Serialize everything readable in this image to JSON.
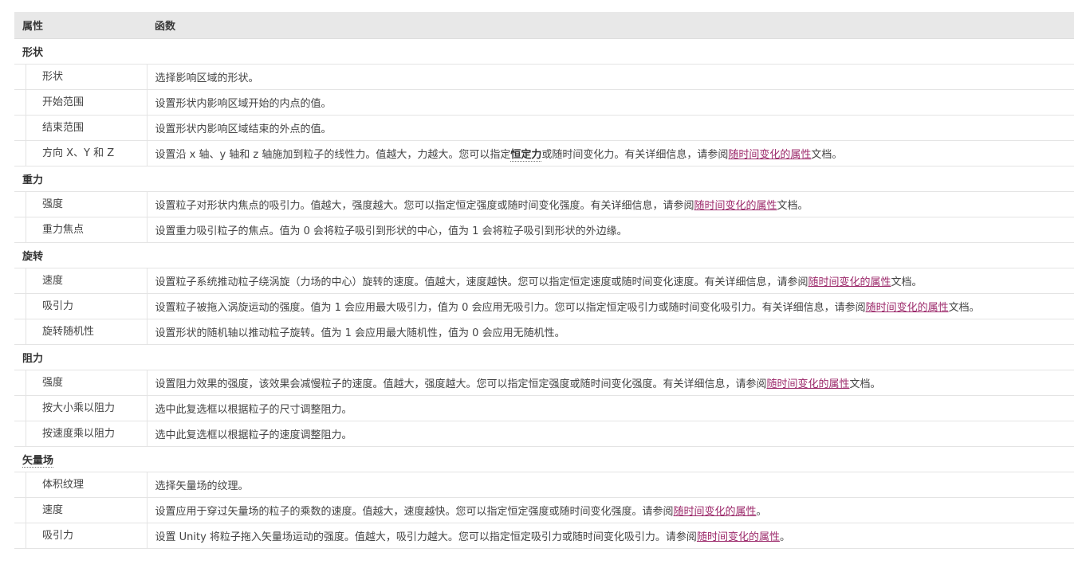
{
  "header": {
    "prop": "属性",
    "func": "函数"
  },
  "sections": [
    {
      "title": "形状",
      "rows": [
        {
          "prop": "形状",
          "before": "选择影响区域的形状。"
        },
        {
          "prop": "开始范围",
          "before": "设置形状内影响区域开始的内点的值。"
        },
        {
          "prop": "结束范围",
          "before": "设置形状内影响区域结束的外点的值。"
        },
        {
          "prop": "方向 X、Y 和 Z",
          "before": "设置沿 x 轴、y 轴和 z 轴施加到粒子的线性力。值越大，力越大。您可以指定",
          "term": "恒定力",
          "middle": "或随时间变化力。有关详细信息，请参阅",
          "link": "随时间变化的属性",
          "after": "文档。"
        }
      ]
    },
    {
      "title": "重力",
      "rows": [
        {
          "prop": "强度",
          "before": "设置粒子对形状内焦点的吸引力。值越大，强度越大。您可以指定恒定强度或随时间变化强度。有关详细信息，请参阅",
          "link": "随时间变化的属性",
          "after": "文档。"
        },
        {
          "prop": "重力焦点",
          "before": "设置重力吸引粒子的焦点。值为 0 会将粒子吸引到形状的中心，值为 1 会将粒子吸引到形状的外边缘。"
        }
      ]
    },
    {
      "title": "旋转",
      "rows": [
        {
          "prop": "速度",
          "before": "设置粒子系统推动粒子绕涡旋（力场的中心）旋转的速度。值越大，速度越快。您可以指定恒定速度或随时间变化速度。有关详细信息，请参阅",
          "link": "随时间变化的属性",
          "after": "文档。"
        },
        {
          "prop": "吸引力",
          "before": "设置粒子被拖入涡旋运动的强度。值为 1 会应用最大吸引力，值为 0 会应用无吸引力。您可以指定恒定吸引力或随时间变化吸引力。有关详细信息，请参阅",
          "link": "随时间变化的属性",
          "after": "文档。"
        },
        {
          "prop": "旋转随机性",
          "before": "设置形状的随机轴以推动粒子旋转。值为 1 会应用最大随机性，值为 0 会应用无随机性。"
        }
      ]
    },
    {
      "title": "阻力",
      "rows": [
        {
          "prop": "强度",
          "before": "设置阻力效果的强度，该效果会减慢粒子的速度。值越大，强度越大。您可以指定恒定强度或随时间变化强度。有关详细信息，请参阅",
          "link": "随时间变化的属性",
          "after": "文档。"
        },
        {
          "prop": "按大小乘以阻力",
          "before": "选中此复选框以根据粒子的尺寸调整阻力。"
        },
        {
          "prop": "按速度乘以阻力",
          "before": "选中此复选框以根据粒子的速度调整阻力。"
        }
      ]
    },
    {
      "title": "矢量场",
      "rows": [
        {
          "prop": "体积纹理",
          "before": "选择矢量场的纹理。"
        },
        {
          "prop": "速度",
          "before": "设置应用于穿过矢量场的粒子的乘数的速度。值越大，速度越快。您可以指定恒定强度或随时间变化强度。请参阅",
          "link": "随时间变化的属性",
          "after": "。"
        },
        {
          "prop": "吸引力",
          "before": "设置 Unity 将粒子拖入矢量场运动的强度。值越大，吸引力越大。您可以指定恒定吸引力或随时间变化吸引力。请参阅",
          "link": "随时间变化的属性",
          "after": "。"
        }
      ]
    }
  ]
}
